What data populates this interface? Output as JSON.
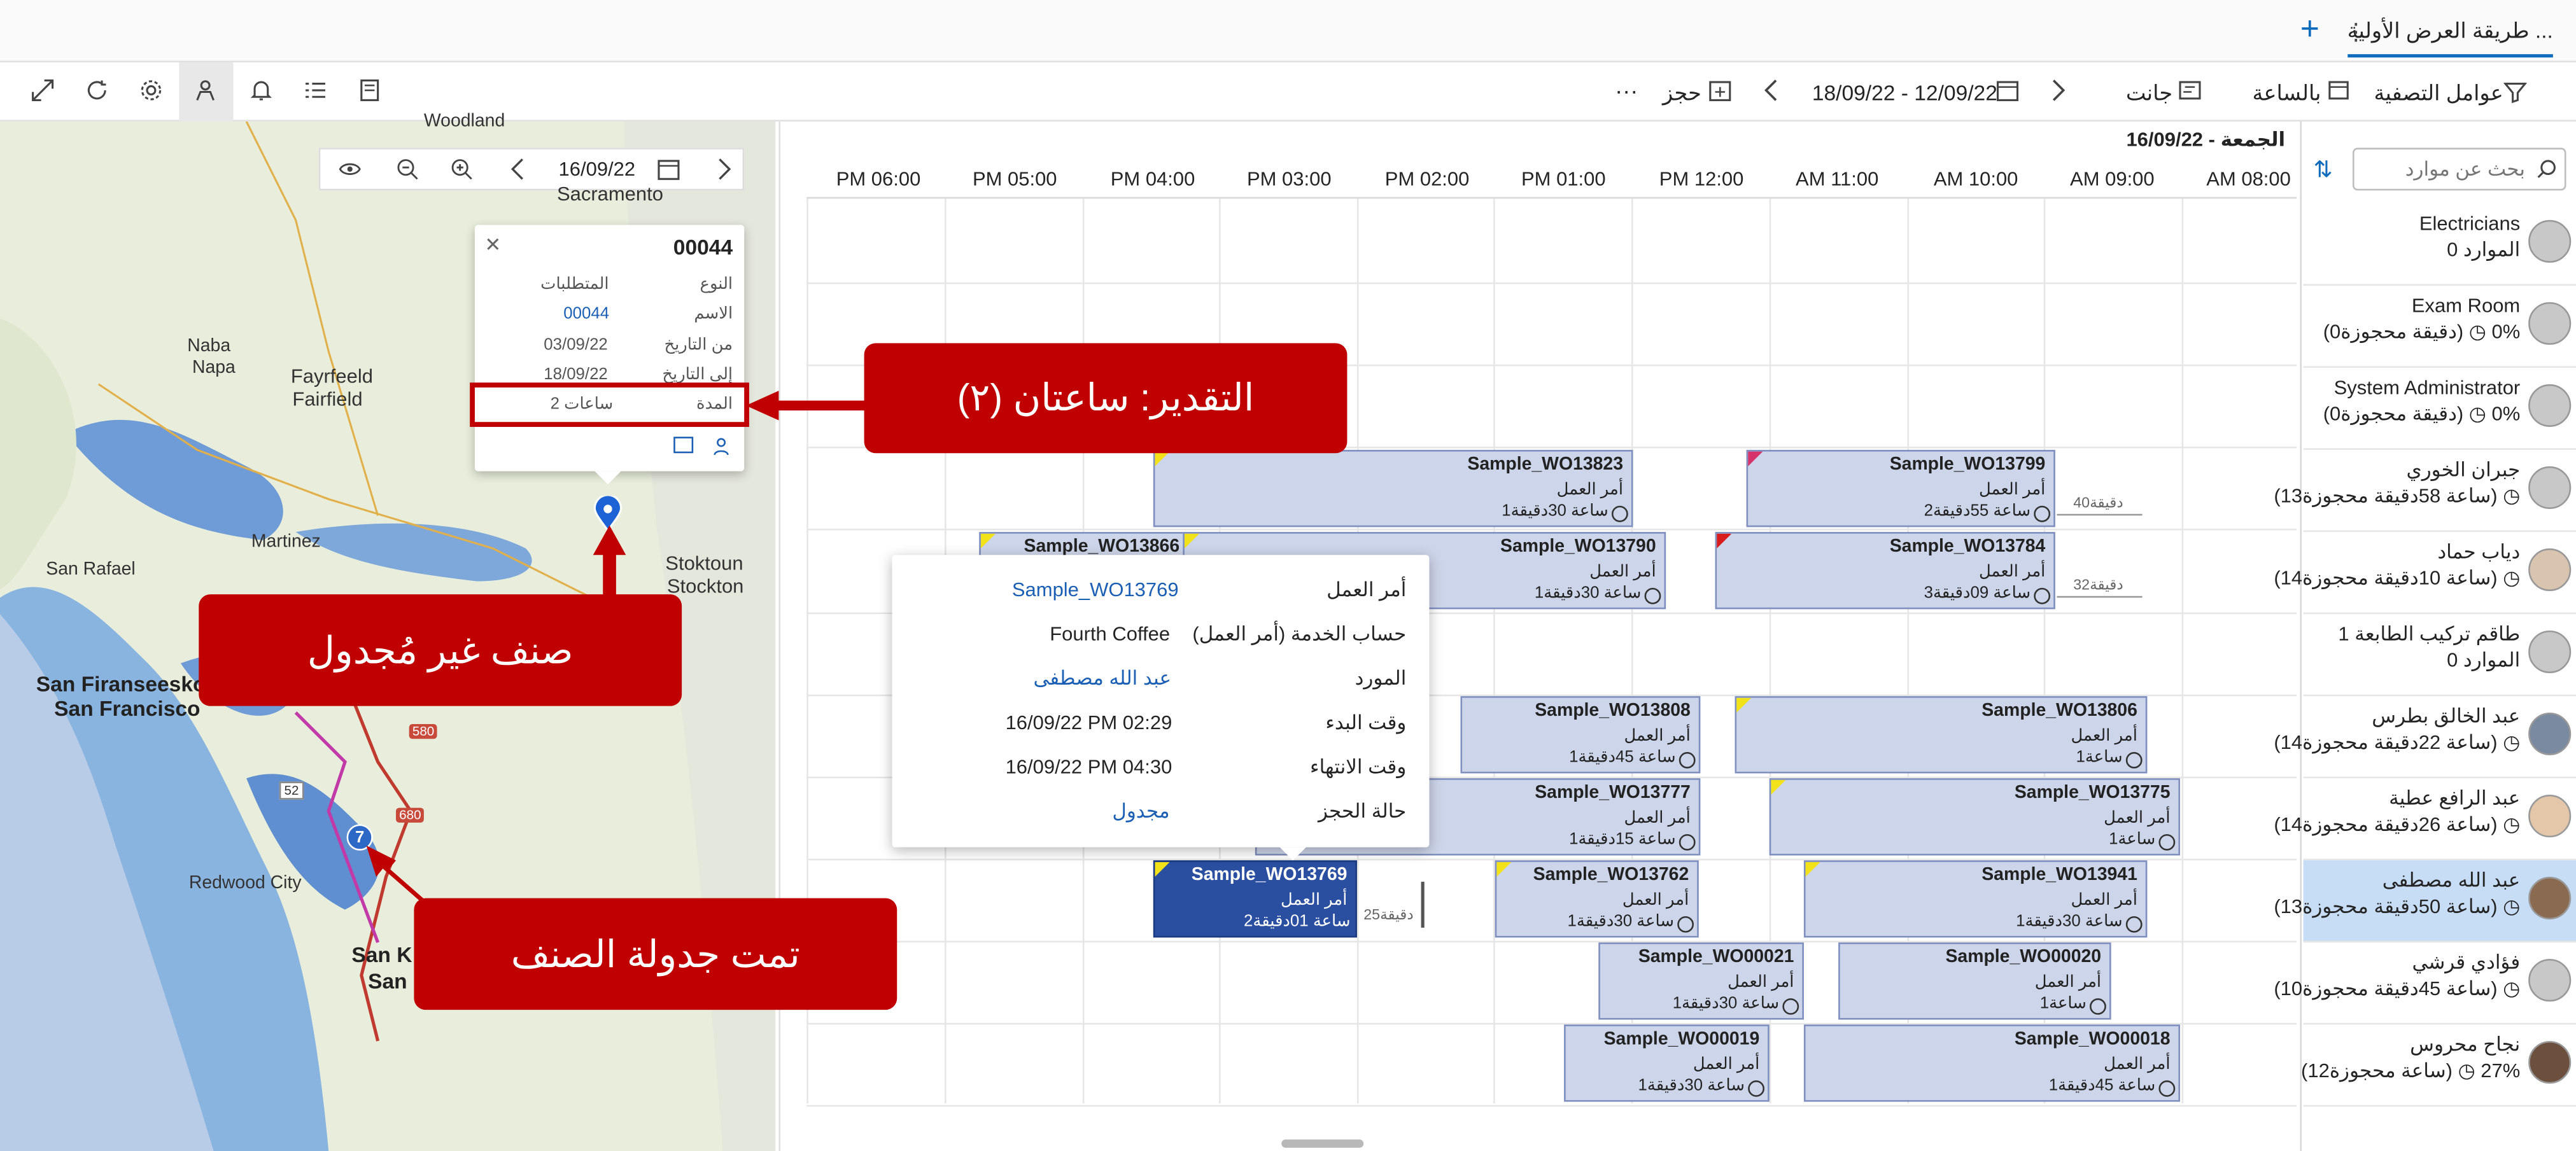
{
  "tabs": {
    "view_title": "طريقة العرض الأولية ...",
    "more": "⋮",
    "add": "+"
  },
  "toolbar": {
    "filter": "عوامل التصفية",
    "hourly": "بالساعة",
    "gantt": "جانت",
    "date_range": "18/09/22 - 12/09/22",
    "book": "حجز",
    "more": "···"
  },
  "resources": {
    "search_placeholder": "بحث عن موارد",
    "items": [
      {
        "name": "Electricians",
        "sub": "0 الموارد"
      },
      {
        "name": "Exam Room",
        "sub": "(0دقيقة محجوزة) ◷ 0%"
      },
      {
        "name": "System Administrator",
        "sub": "(0دقيقة محجوزة) ◷ 0%"
      },
      {
        "name": "جبران الخوري",
        "sub": "(13ساعة 58دقيقة محجوزة) ◷"
      },
      {
        "name": "دياب حماد",
        "sub": "(14ساعة 10دقيقة محجوزة) ◷"
      },
      {
        "name": "طاقم تركيب الطابعة 1",
        "sub": "0 الموارد"
      },
      {
        "name": "عبد الخالق بطرس",
        "sub": "(14ساعة 22دقيقة محجوزة) ◷"
      },
      {
        "name": "عبد الرافع عطية",
        "sub": "(14ساعة 26دقيقة محجوزة) ◷"
      },
      {
        "name": "عبد الله مصطفى",
        "sub": "(13ساعة 50دقيقة محجوزة) ◷"
      },
      {
        "name": "فؤادي قرشي",
        "sub": "(10ساعة 45دقيقة محجوزة) ◷"
      },
      {
        "name": "نجاح محروس",
        "sub": "(12ساعة محجوزة) ◷ 27%"
      }
    ]
  },
  "schedule": {
    "date_label": "الجمعة - 16/09/22",
    "hours": [
      "AM 08:00",
      "AM 09:00",
      "AM 10:00",
      "AM 11:00",
      "PM 12:00",
      "PM 01:00",
      "PM 02:00",
      "PM 03:00",
      "PM 04:00",
      "PM 05:00",
      "PM 06:00"
    ],
    "travel_a": "40دقيقة",
    "travel_b": "32دقيقة",
    "travel_c": "25دقيقة",
    "bookings": [
      {
        "title": "Sample_WO13823",
        "type": "أمر العمل",
        "dur": "1ساعة 30دقيقة"
      },
      {
        "title": "Sample_WO13799",
        "type": "أمر العمل",
        "dur": "2ساعة 55دقيقة"
      },
      {
        "title": "Sample_WO13866",
        "type": "",
        "dur": ""
      },
      {
        "title": "Sample_WO13790",
        "type": "أمر العمل",
        "dur": "1ساعة 30دقيقة"
      },
      {
        "title": "Sample_WO13784",
        "type": "أمر العمل",
        "dur": "3ساعة 09دقيقة"
      },
      {
        "title": "Sample_WO13808",
        "type": "أمر العمل",
        "dur": "1ساعة 45دقيقة"
      },
      {
        "title": "Sample_WO13806",
        "type": "أمر العمل",
        "dur": "1ساعة"
      },
      {
        "title": "Sample_WO13777",
        "type": "أمر العمل",
        "dur": "1ساعة 15دقيقة"
      },
      {
        "title": "Sample_WO13775",
        "type": "أمر العمل",
        "dur": "1ساعة"
      },
      {
        "title": "Sample_WO13769",
        "type": "أمر العمل",
        "dur": "2ساعة 01دقيقة"
      },
      {
        "title": "Sample_WO13762",
        "type": "أمر العمل",
        "dur": "1ساعة 30دقيقة"
      },
      {
        "title": "Sample_WO13941",
        "type": "أمر العمل",
        "dur": "1ساعة 30دقيقة"
      },
      {
        "title": "Sample_WO00021",
        "type": "أمر العمل",
        "dur": "1ساعة 30دقيقة"
      },
      {
        "title": "Sample_WO00020",
        "type": "أمر العمل",
        "dur": "1ساعة"
      },
      {
        "title": "Sample_WO00019",
        "type": "أمر العمل",
        "dur": "1ساعة 30دقيقة"
      },
      {
        "title": "Sample_WO00018",
        "type": "أمر العمل",
        "dur": "1ساعة 45دقيقة"
      }
    ]
  },
  "tooltip": {
    "rows": [
      {
        "label": "أمر العمل",
        "value": "Sample_WO13769"
      },
      {
        "label": "حساب الخدمة (أمر العمل)",
        "value": "Fourth Coffee"
      },
      {
        "label": "المورد",
        "value": "عبد الله مصطفى"
      },
      {
        "label": "وقت البدء",
        "value": "16/09/22 PM 02:29"
      },
      {
        "label": "وقت الانتهاء",
        "value": "16/09/22 PM 04:30"
      },
      {
        "label": "حالة الحجز",
        "value": "مجدول"
      }
    ]
  },
  "map": {
    "date": "16/09/22",
    "cities": [
      "Woodland",
      "Sacramento",
      "Naba",
      "Napa",
      "Fayrfeeld",
      "Fairfield",
      "Martinez",
      "San Rafael",
      "Stoktoun",
      "Stockton",
      "San Firanseesko",
      "San Francisco",
      "Redwood City",
      "San K",
      "San"
    ],
    "route_badge": "7",
    "highway_a": "580",
    "highway_b": "680",
    "highway_c": "52"
  },
  "popup": {
    "id": "00044",
    "rows": [
      {
        "label": "النوع",
        "value": "المتطلبات"
      },
      {
        "label": "الاسم",
        "value": "00044"
      },
      {
        "label": "من التاريخ",
        "value": "03/09/22"
      },
      {
        "label": "إلى التاريخ",
        "value": "18/09/22"
      },
      {
        "label": "المدة",
        "value": "2 ساعات"
      }
    ]
  },
  "callouts": {
    "estimate": "التقدير: ساعتان (٢)",
    "unscheduled": "صنف غير مُجدول",
    "scheduled": "تمت جدولة الصنف"
  },
  "colors": {
    "accent": "#0f6cbd",
    "callout": "#c00000",
    "booking": "#cdd5ea",
    "booking_selected": "#2b4fa0"
  }
}
